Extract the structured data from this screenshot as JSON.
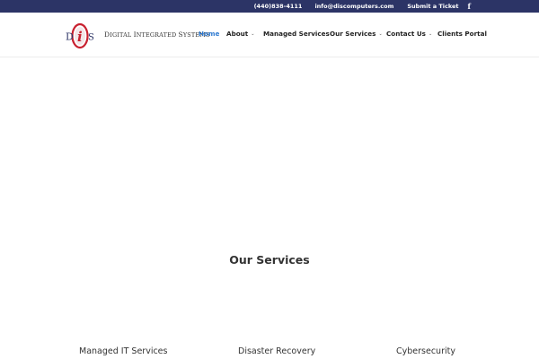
{
  "topbar": {
    "phone": "(440)838-4111",
    "email": "info@discomputers.com",
    "ticket": "Submit a Ticket",
    "social_icon": "facebook-icon",
    "social_glyph": "f",
    "background": "#2c3466"
  },
  "brand": {
    "name_part1_initial": "D",
    "name_part1_rest": "IGITAL ",
    "name_part2_initial": "I",
    "name_part2_rest": "NTEGRATED ",
    "name_part3_initial": "S",
    "name_part3_rest": "YSTEMS",
    "logo_letters": [
      "D",
      "i",
      "S"
    ],
    "accent": "#c8202f"
  },
  "nav": {
    "items": [
      {
        "label": "Home",
        "active": true,
        "has_dropdown": false
      },
      {
        "label": "About",
        "active": false,
        "has_dropdown": true
      },
      {
        "label": "Managed Services",
        "active": false,
        "has_dropdown": false
      },
      {
        "label": "Our Services",
        "active": false,
        "has_dropdown": true
      },
      {
        "label": "Contact Us",
        "active": false,
        "has_dropdown": true
      },
      {
        "label": "Clients Portal",
        "active": false,
        "has_dropdown": false
      }
    ],
    "active_color": "#2e7ad1"
  },
  "main": {
    "section_title": "Our Services",
    "services": [
      "Managed IT Services",
      "Disaster Recovery",
      "Cybersecurity"
    ]
  }
}
